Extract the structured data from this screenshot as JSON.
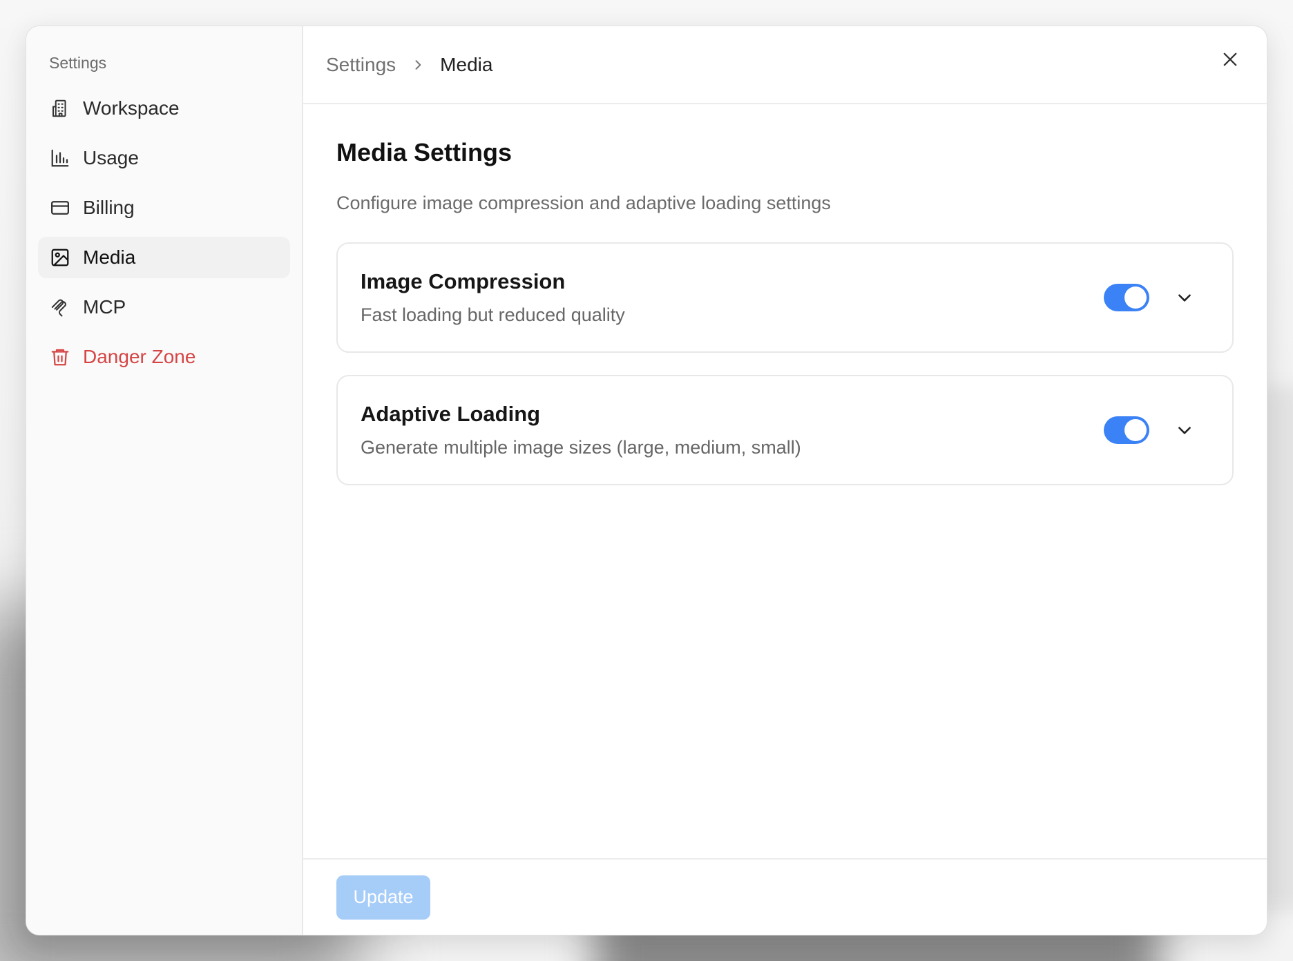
{
  "sidebar": {
    "heading": "Settings",
    "items": [
      {
        "label": "Workspace",
        "icon": "building-icon"
      },
      {
        "label": "Usage",
        "icon": "bar-chart-icon"
      },
      {
        "label": "Billing",
        "icon": "credit-card-icon"
      },
      {
        "label": "Media",
        "icon": "image-icon",
        "active": true
      },
      {
        "label": "MCP",
        "icon": "mcp-icon"
      },
      {
        "label": "Danger Zone",
        "icon": "trash-icon",
        "danger": true
      }
    ]
  },
  "breadcrumb": {
    "root": "Settings",
    "current": "Media"
  },
  "main": {
    "title": "Media Settings",
    "subtitle": "Configure image compression and adaptive loading settings",
    "cards": [
      {
        "title": "Image Compression",
        "description": "Fast loading but reduced quality",
        "enabled": true
      },
      {
        "title": "Adaptive Loading",
        "description": "Generate multiple image sizes (large, medium, small)",
        "enabled": true
      }
    ]
  },
  "footer": {
    "update_label": "Update"
  },
  "colors": {
    "accent": "#3b82f6",
    "danger": "#d64545",
    "button_disabled": "#a6ccf8"
  }
}
